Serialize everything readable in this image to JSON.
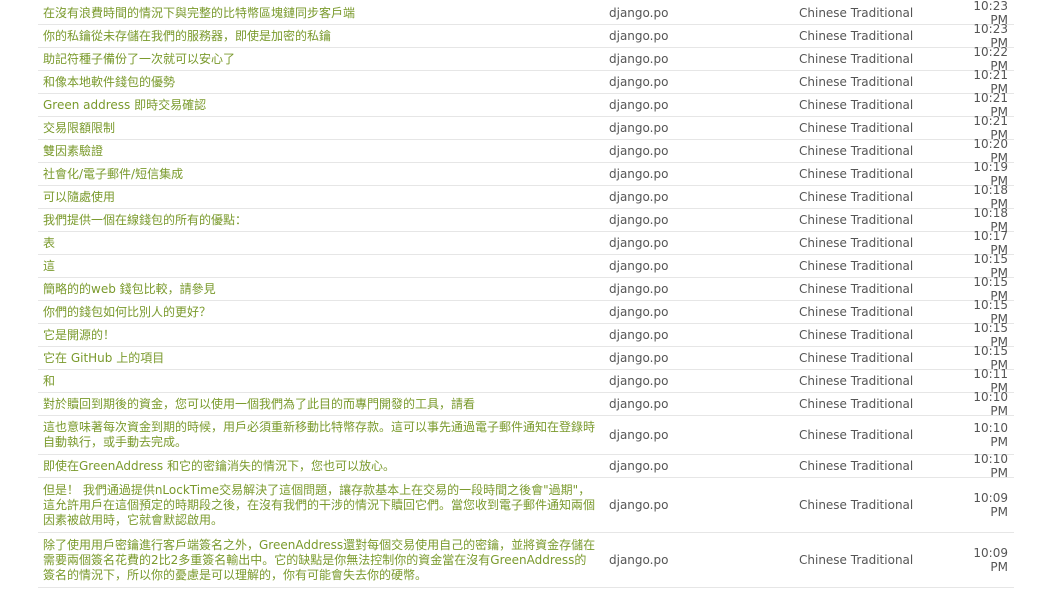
{
  "rows": [
    {
      "text": "在沒有浪費時間的情況下與完整的比特幣區塊鏈同步客戶端",
      "file": "django.po",
      "language": "Chinese Traditional",
      "time": "10:23 PM"
    },
    {
      "text": "你的私鑰從未存儲在我們的服務器，即使是加密的私鑰",
      "file": "django.po",
      "language": "Chinese Traditional",
      "time": "10:23 PM"
    },
    {
      "text": "助記符種子備份了一次就可以安心了",
      "file": "django.po",
      "language": "Chinese Traditional",
      "time": "10:22 PM"
    },
    {
      "text": "和像本地軟件錢包的優勢",
      "file": "django.po",
      "language": "Chinese Traditional",
      "time": "10:21 PM"
    },
    {
      "text": "Green address 即時交易確認",
      "file": "django.po",
      "language": "Chinese Traditional",
      "time": "10:21 PM"
    },
    {
      "text": "交易限額限制",
      "file": "django.po",
      "language": "Chinese Traditional",
      "time": "10:21 PM"
    },
    {
      "text": "雙因素驗證",
      "file": "django.po",
      "language": "Chinese Traditional",
      "time": "10:20 PM"
    },
    {
      "text": "社會化/電子郵件/短信集成",
      "file": "django.po",
      "language": "Chinese Traditional",
      "time": "10:19 PM"
    },
    {
      "text": "可以隨處使用",
      "file": "django.po",
      "language": "Chinese Traditional",
      "time": "10:18 PM"
    },
    {
      "text": "我們提供一個在線錢包的所有的優點：",
      "file": "django.po",
      "language": "Chinese Traditional",
      "time": "10:18 PM"
    },
    {
      "text": "表",
      "file": "django.po",
      "language": "Chinese Traditional",
      "time": "10:17 PM"
    },
    {
      "text": "這",
      "file": "django.po",
      "language": "Chinese Traditional",
      "time": "10:15 PM"
    },
    {
      "text": "簡略的的web 錢包比較，請參見",
      "file": "django.po",
      "language": "Chinese Traditional",
      "time": "10:15 PM"
    },
    {
      "text": "你們的錢包如何比別人的更好？",
      "file": "django.po",
      "language": "Chinese Traditional",
      "time": "10:15 PM"
    },
    {
      "text": "它是開源的！",
      "file": "django.po",
      "language": "Chinese Traditional",
      "time": "10:15 PM"
    },
    {
      "text": "它在 GitHub 上的項目",
      "file": "django.po",
      "language": "Chinese Traditional",
      "time": "10:15 PM"
    },
    {
      "text": "和",
      "file": "django.po",
      "language": "Chinese Traditional",
      "time": "10:11 PM"
    },
    {
      "text": "對於贖回到期後的資金，您可以使用一個我們為了此目的而專門開發的工具，請看",
      "file": "django.po",
      "language": "Chinese Traditional",
      "time": "10:10 PM"
    },
    {
      "text": "這也意味著每次資金到期的時候，用戶必須重新移動比特幣存款。這可以事先通過電子郵件通知在登錄時自動執行，或手動去完成。",
      "file": "django.po",
      "language": "Chinese Traditional",
      "time": "10:10 PM",
      "size": "tall2"
    },
    {
      "text": "即使在GreenAddress 和它的密鑰消失的情況下，您也可以放心。",
      "file": "django.po",
      "language": "Chinese Traditional",
      "time": "10:10 PM"
    },
    {
      "text": "但是！ 我們通過提供nLockTime交易解決了這個問題，讓存款基本上在交易的一段時間之後會\"過期\"，這允許用戶在這個預定的時期段之後，在沒有我們的干涉的情況下贖回它們。當您收到電子郵件通知兩個因素被啟用時，它就會默認啟用。",
      "file": "django.po",
      "language": "Chinese Traditional",
      "time": "10:09 PM",
      "size": "tall3"
    },
    {
      "text": "除了使用用戶密鑰進行客戶端簽名之外，GreenAddress還對每個交易使用自己的密鑰，並將資金存儲在需要兩個簽名花費的2比2多重簽名輸出中。它的缺點是你無法控制你的資金當在沒有GreenAddress的簽名的情況下，所以你的憂慮是可以理解的，你有可能會失去你的硬幣。",
      "file": "django.po",
      "language": "Chinese Traditional",
      "time": "10:09 PM",
      "size": "tall3"
    }
  ]
}
